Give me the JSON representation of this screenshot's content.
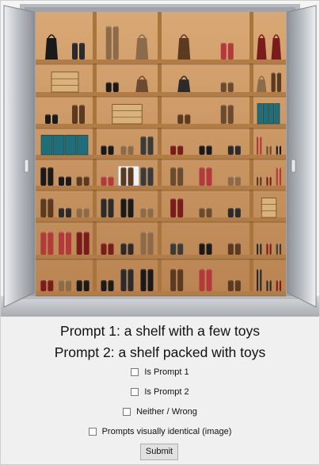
{
  "image": {
    "alt": "Open metal cabinet with wooden shelves holding shoes, handbags and boxes"
  },
  "prompts": {
    "prompt1": "Prompt 1: a shelf with a few toys",
    "prompt2": "Prompt 2: a shelf packed with toys"
  },
  "options": [
    {
      "label": "Is Prompt 1",
      "checked": false
    },
    {
      "label": "Is Prompt 2",
      "checked": false
    },
    {
      "label": "Neither / Wrong",
      "checked": false
    },
    {
      "label": "Prompts visually identical (image)",
      "checked": false
    }
  ],
  "submit_label": "Submit",
  "colors": {
    "page_bg": "#f0f0f0",
    "wood": "#c8955f",
    "wood_dark": "#8a5a2e",
    "metal": "#c9ccd0",
    "teal_box": "#1f6e7a"
  }
}
